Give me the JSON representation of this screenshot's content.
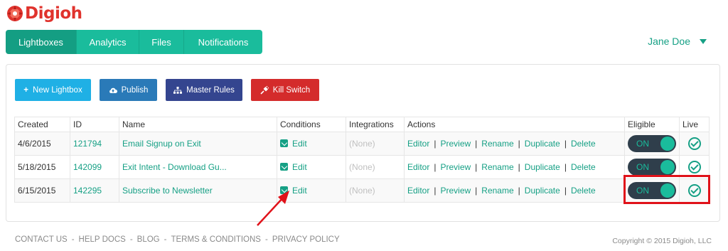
{
  "brand": {
    "name": "Digioh",
    "color": "#e0332d"
  },
  "nav": {
    "tabs": [
      {
        "label": "Lightboxes",
        "active": true
      },
      {
        "label": "Analytics",
        "active": false
      },
      {
        "label": "Files",
        "active": false
      },
      {
        "label": "Notifications",
        "active": false
      }
    ]
  },
  "user": {
    "name": "Jane Doe"
  },
  "toolbar": {
    "new_label": "New Lightbox",
    "publish_label": "Publish",
    "master_label": "Master Rules",
    "kill_label": "Kill Switch"
  },
  "table": {
    "headers": [
      "Created",
      "ID",
      "Name",
      "Conditions",
      "Integrations",
      "Actions",
      "Eligible",
      "Live"
    ],
    "rows": [
      {
        "created": "4/6/2015",
        "id": "121794",
        "name": "Email Signup on Exit",
        "conditions": "Edit",
        "integrations": "(None)",
        "eligible": "ON",
        "live": true
      },
      {
        "created": "5/18/2015",
        "id": "142099",
        "name": "Exit Intent - Download Gu...",
        "conditions": "Edit",
        "integrations": "(None)",
        "eligible": "ON",
        "live": true
      },
      {
        "created": "6/15/2015",
        "id": "142295",
        "name": "Subscribe to Newsletter",
        "conditions": "Edit",
        "integrations": "(None)",
        "eligible": "ON",
        "live": true
      }
    ],
    "actions": [
      "Editor",
      "Preview",
      "Rename",
      "Duplicate",
      "Delete"
    ],
    "action_separator": "|"
  },
  "footer": {
    "links": [
      "CONTACT US",
      "HELP DOCS",
      "BLOG",
      "TERMS & CONDITIONS",
      "PRIVACY POLICY"
    ],
    "separator": "-",
    "copyright": "Copyright © 2015 Digioh, LLC"
  },
  "colors": {
    "accent": "#1abc9c",
    "accent_dark": "#16a085",
    "toggle_bg": "#2f3e4b",
    "annotation": "#e0121a"
  }
}
